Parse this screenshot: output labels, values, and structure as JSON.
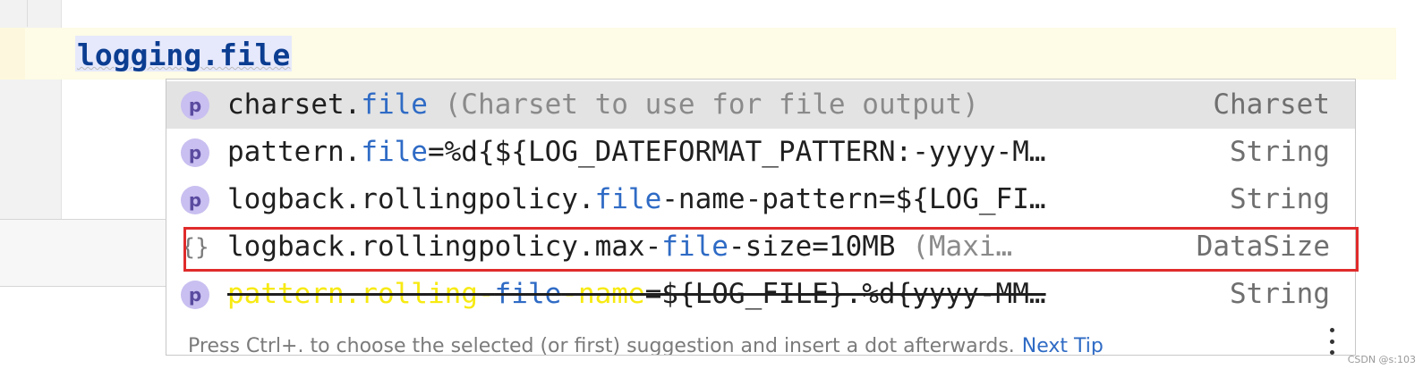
{
  "editor": {
    "line_text": "logging.file"
  },
  "popup": {
    "items": [
      {
        "icon": "p",
        "pre": "charset.",
        "match": "file",
        "post": "",
        "hint": " (Charset to use for file output)",
        "type": "Charset"
      },
      {
        "icon": "p",
        "pre": "pattern.",
        "match": "file",
        "post": "=%d{${LOG_DATEFORMAT_PATTERN:-yyyy-M…",
        "hint": "",
        "type": "String"
      },
      {
        "icon": "p",
        "pre": "logback.rollingpolicy.",
        "match": "file",
        "post": "-name-pattern=${LOG_FI…",
        "hint": "",
        "type": "String"
      },
      {
        "icon": "{}",
        "pre": "logback.rollingpolicy.max-",
        "match": "file",
        "post": "-size=10MB",
        "hint": " (Maxi…",
        "type": "DataSize"
      },
      {
        "icon": "p",
        "pre": "pattern.rolling-",
        "match": "file",
        "post": "-name",
        "post2": "=${LOG_FILE}.%d{yyyy-MM…",
        "hint": "",
        "type": "String"
      }
    ],
    "footer_text": "Press Ctrl+. to choose the selected (or first) suggestion and insert a dot afterwards.",
    "next_tip": "Next Tip"
  },
  "watermark": "CSDN @s:103",
  "colors": {
    "match": "#2f6bc5",
    "selected_row": "#e3e3e3",
    "highlight_border": "#e02b2b",
    "deprecated_yellow": "#f7ea12"
  }
}
